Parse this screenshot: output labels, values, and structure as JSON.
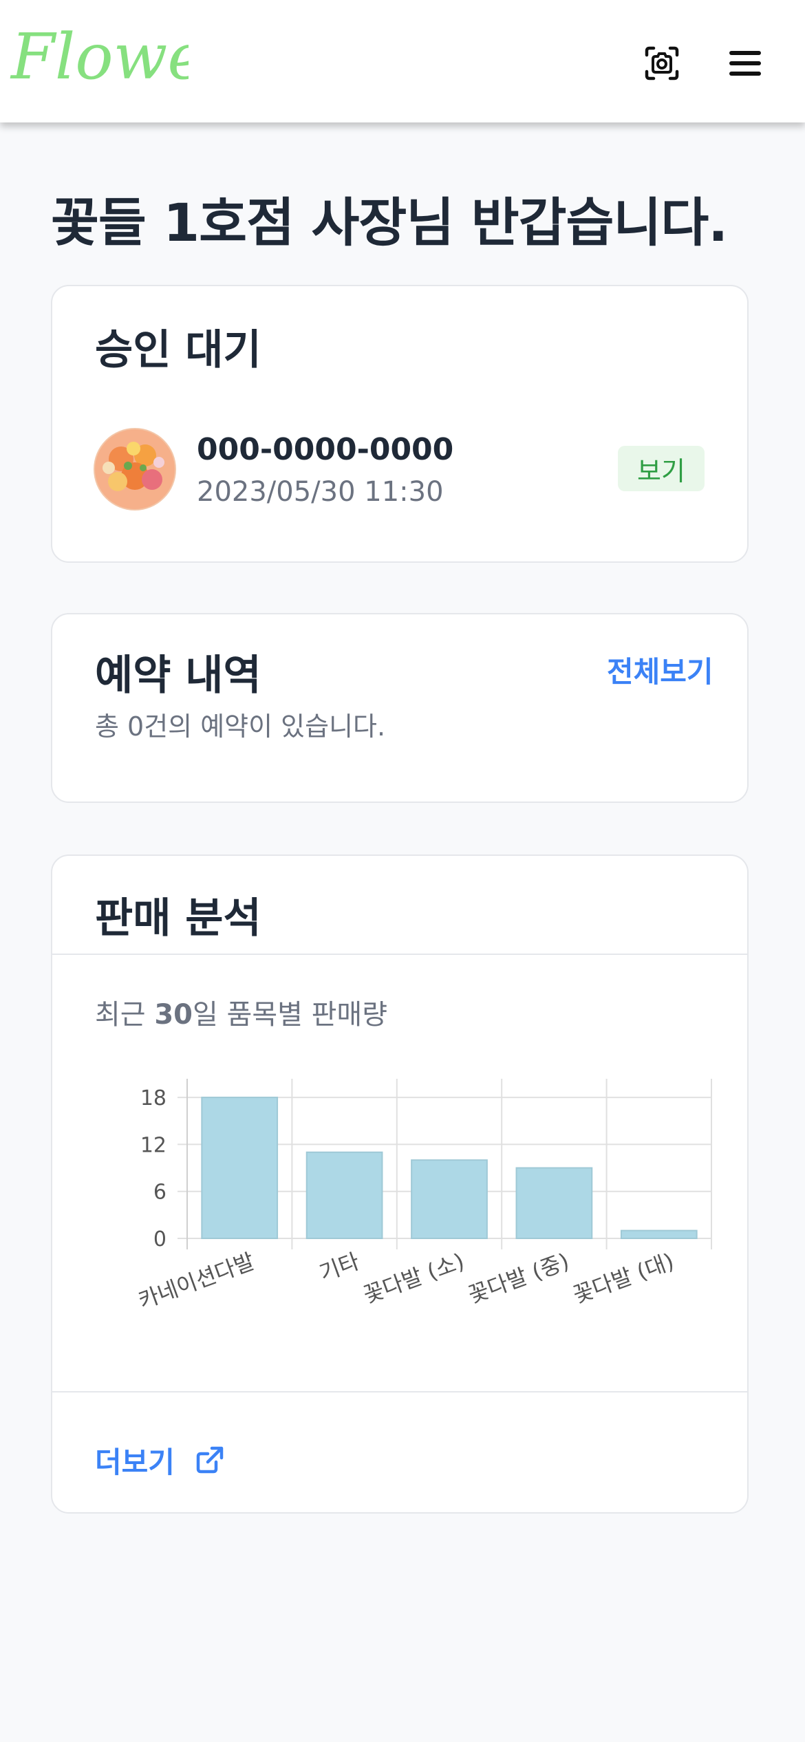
{
  "header": {
    "logo_text": "Flowery",
    "camera_icon": "camera-capture-icon",
    "menu_icon": "hamburger-menu-icon"
  },
  "greeting": "꽃들 1호점 사장님 반갑습니다.",
  "approval": {
    "title": "승인 대기",
    "item": {
      "phone": "000-0000-0000",
      "datetime": "2023/05/30 11:30",
      "view_label": "보기"
    }
  },
  "reservations": {
    "title": "예약 내역",
    "view_all_label": "전체보기",
    "count_text": "총 0건의 예약이 있습니다."
  },
  "sales": {
    "title": "판매 분석",
    "subtitle_prefix": "최근 ",
    "subtitle_num": "30",
    "subtitle_suffix": "일 품목별 판매량",
    "more_label": "더보기",
    "more_icon": "external-link-icon"
  },
  "colors": {
    "brand": "#86e07f",
    "accent": "#3b82f6",
    "bar": "#add8e6",
    "badge_bg": "#e9f7ea",
    "badge_text": "#2f9e44"
  },
  "chart_data": {
    "type": "bar",
    "categories": [
      "카네이션다발",
      "기타",
      "꽃다발 (소)",
      "꽃다발 (중)",
      "꽃다발 (대)"
    ],
    "values": [
      18,
      11,
      10,
      9,
      1
    ],
    "yticks": [
      0,
      6,
      12,
      18
    ],
    "ylim": [
      0,
      20
    ],
    "grid": true,
    "title": "",
    "xlabel": "",
    "ylabel": ""
  }
}
